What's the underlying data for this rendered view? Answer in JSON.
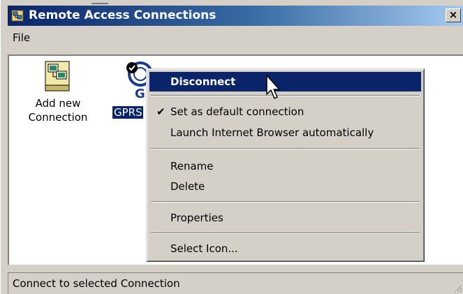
{
  "window": {
    "title": "Remote Access Connections",
    "close_glyph": "×"
  },
  "menubar": {
    "file": "File"
  },
  "content": {
    "items": [
      {
        "label_line1": "Add new",
        "label_line2": "Connection",
        "icon": "add-connection-icon"
      },
      {
        "label": "GPRS",
        "letter": "G",
        "icon": "gprs-connection-icon",
        "selected": true
      }
    ]
  },
  "context_menu": {
    "items": [
      {
        "label": "Disconnect",
        "highlighted": true
      },
      {
        "label": "Set as default connection",
        "checked": true
      },
      {
        "label": "Launch Internet Browser automatically"
      },
      {
        "label": "Rename"
      },
      {
        "label": "Delete"
      },
      {
        "label": "Properties"
      },
      {
        "label": "Select Icon..."
      }
    ],
    "check_glyph": "✔"
  },
  "statusbar": {
    "text": "Connect to selected Connection"
  },
  "colors": {
    "titlebar_start": "#0a246a",
    "titlebar_end": "#a6caf0",
    "highlight": "#0a246a",
    "face": "#d4d0c8"
  }
}
